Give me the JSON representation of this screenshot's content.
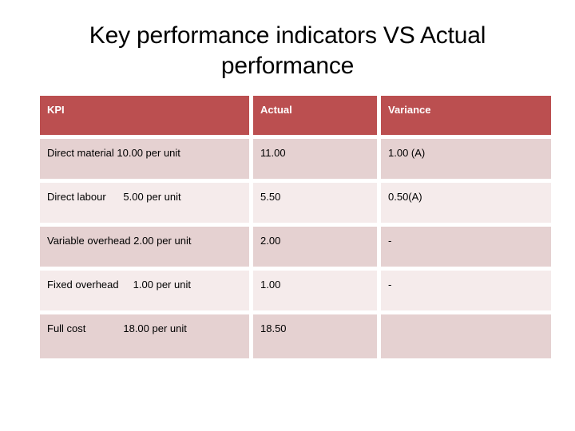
{
  "slide": {
    "title": "Key performance indicators VS Actual performance",
    "background_color": "#ffffff"
  },
  "table": {
    "header_bg": "#bb4f50",
    "header_text_color": "#ffffff",
    "row_dark_bg": "#e5d1d1",
    "row_light_bg": "#f5ebeb",
    "columns": [
      "KPI",
      "Actual",
      "Variance"
    ],
    "rows": [
      {
        "kpi": "Direct material 10.00 per unit",
        "actual": "11.00",
        "variance": "1.00 (A)",
        "shade": "dark"
      },
      {
        "kpi": "Direct labour      5.00 per unit",
        "actual": "5.50",
        "variance": "0.50(A)",
        "shade": "light"
      },
      {
        "kpi": "Variable overhead 2.00 per unit",
        "actual": "2.00",
        "variance": "-",
        "shade": "dark"
      },
      {
        "kpi": "Fixed overhead     1.00 per unit",
        "actual": "1.00",
        "variance": "-",
        "shade": "light"
      },
      {
        "kpi": "Full cost             18.00 per unit",
        "actual": "18.50",
        "variance": "",
        "shade": "dark"
      }
    ]
  }
}
